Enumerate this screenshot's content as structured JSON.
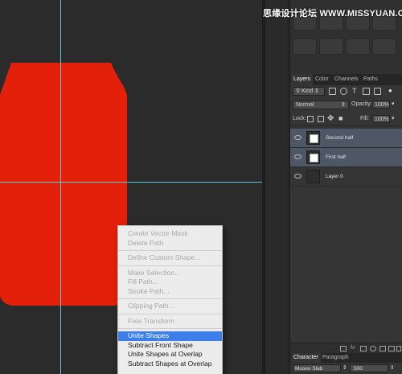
{
  "watermark": "思缘设计论坛 WWW.MISSYUAN.COM",
  "colors": {
    "shape_fill": "#e3200a",
    "guide": "#5fc9d6",
    "menu_highlight": "#3d7fea",
    "selected_layer": "#4d5766"
  },
  "context_menu": {
    "items": [
      {
        "label": "Create Vector Mask",
        "enabled": false
      },
      {
        "label": "Delete Path",
        "enabled": false
      },
      {
        "label": "Define Custom Shape...",
        "enabled": false
      },
      {
        "label": "Make Selection...",
        "enabled": false
      },
      {
        "label": "Fill Path...",
        "enabled": false
      },
      {
        "label": "Stroke Path...",
        "enabled": false
      },
      {
        "label": "Clipping Path...",
        "enabled": false
      },
      {
        "label": "Free Transform",
        "enabled": false
      },
      {
        "label": "Unite Shapes",
        "enabled": true,
        "selected": true
      },
      {
        "label": "Subtract Front Shape",
        "enabled": true
      },
      {
        "label": "Unite Shapes at Overlap",
        "enabled": true
      },
      {
        "label": "Subtract Shapes at Overlap",
        "enabled": true
      }
    ]
  },
  "layers_panel": {
    "tabs": [
      "Layers",
      "Color",
      "Channels",
      "Paths"
    ],
    "active_tab": "Layers",
    "filter_kind": "Kind",
    "blend_mode": "Normal",
    "opacity_label": "Opacity:",
    "opacity_value": "100%",
    "lock_label": "Lock:",
    "fill_label": "Fill:",
    "fill_value": "100%",
    "layers": [
      {
        "name": "Second half",
        "selected": true,
        "type": "shape"
      },
      {
        "name": "First half",
        "selected": true,
        "type": "shape"
      },
      {
        "name": "Layer 0",
        "selected": false,
        "type": "raster"
      }
    ]
  },
  "character_panel": {
    "tabs": [
      "Character",
      "Paragraph"
    ],
    "font": "Museo Slab",
    "size": "500"
  }
}
